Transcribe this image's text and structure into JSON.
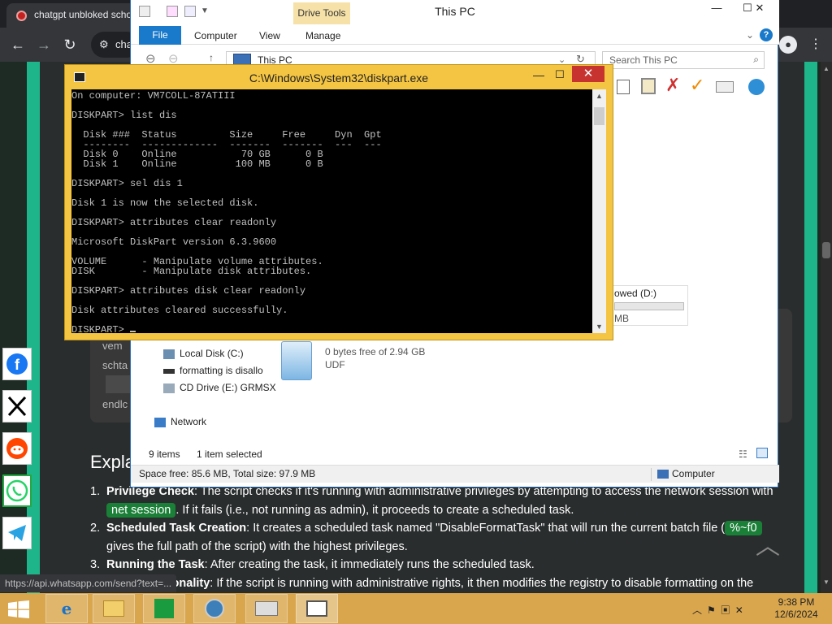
{
  "browser": {
    "tab_title": "chatgpt unbloked scho",
    "omnibox_text": "cha",
    "status_url": "https://api.whatsapp.com/send?text=..."
  },
  "article": {
    "code_partials": [
      "vem",
      "schta",
      "endlc"
    ],
    "heading": "Expla",
    "items": [
      {
        "num": "1.",
        "bold": "Privilege Check",
        "pre": ": The script checks if it's running with administrative privileges by attempting to access the network session with ",
        "code": "net session",
        "post": ". If it fails (i.e., not running as admin), it proceeds to create a scheduled task."
      },
      {
        "num": "2.",
        "bold": "Scheduled Task Creation",
        "pre": ": It creates a scheduled task named \"DisableFormatTask\" that will run the current batch file (",
        "code": "%~f0",
        "post": " gives the full path of the script) with the highest privileges."
      },
      {
        "num": "3.",
        "bold": "Running the Task",
        "pre": ": After creating the task, it immediately runs the scheduled task.",
        "code": "",
        "post": ""
      },
      {
        "num": "4.",
        "bold": "Main Functionality",
        "pre": ": If the script is running with administrative rights, it then modifies the registry to disable formatting on the",
        "code": "",
        "post": ""
      }
    ]
  },
  "explorer": {
    "title": "This PC",
    "drive_tools": "Drive Tools",
    "ribbon_tabs": [
      "File",
      "Computer",
      "View",
      "Manage"
    ],
    "address": "This PC",
    "search_placeholder": "Search This PC",
    "tree": [
      {
        "label": "Local Disk (C:)",
        "icon": "drive-icon"
      },
      {
        "label": "formatting is disallo",
        "icon": "usb-drive-icon"
      },
      {
        "label": "CD Drive (E:) GRMSX",
        "icon": "cd-drive-icon"
      },
      {
        "label": "Network",
        "icon": "network-icon"
      }
    ],
    "dvd_free": "0 bytes free of 2.94 GB",
    "dvd_fs": "UDF",
    "allowed_label": "owed (D:)",
    "allowed_size": "MB",
    "items_count": "9 items",
    "selected_count": "1 item selected",
    "space_info": "Space free: 85.6 MB, Total size: 97.9 MB",
    "computer_label": "Computer"
  },
  "cmd": {
    "title": "C:\\Windows\\System32\\diskpart.exe",
    "lines": [
      "On computer: VM7COLL-87ATIII",
      "",
      "DISKPART> list dis",
      "",
      "  Disk ###  Status         Size     Free     Dyn  Gpt",
      "  --------  -------------  -------  -------  ---  ---",
      "  Disk 0    Online           70 GB      0 B",
      "  Disk 1    Online          100 MB      0 B",
      "",
      "DISKPART> sel dis 1",
      "",
      "Disk 1 is now the selected disk.",
      "",
      "DISKPART> attributes clear readonly",
      "",
      "Microsoft DiskPart version 6.3.9600",
      "",
      "VOLUME      - Manipulate volume attributes.",
      "DISK        - Manipulate disk attributes.",
      "",
      "DISKPART> attributes disk clear readonly",
      "",
      "Disk attributes cleared successfully.",
      "",
      "DISKPART> "
    ]
  },
  "taskbar": {
    "time": "9:38 PM",
    "date": "12/6/2024"
  },
  "colors": {
    "accent_green": "#1fb58a",
    "cmd_frame": "#f4c542",
    "taskbar": "#d9a64e",
    "explorer_file_tab": "#1979ca"
  }
}
